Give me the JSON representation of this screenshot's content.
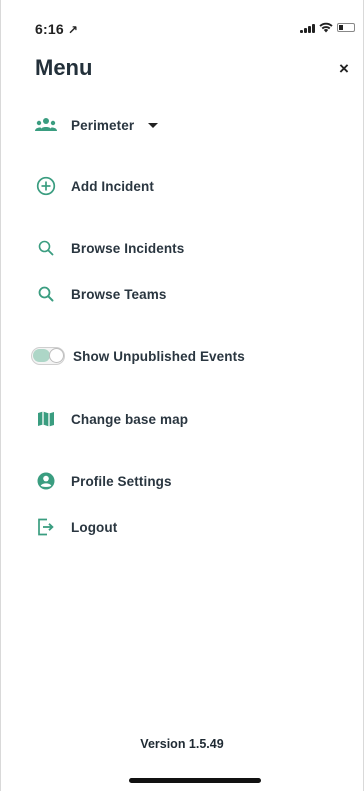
{
  "status_bar": {
    "time": "6:16",
    "location_glyph": "↗"
  },
  "header": {
    "title": "Menu",
    "close_glyph": "×"
  },
  "menu": {
    "team_selector": {
      "label": "Perimeter",
      "icon": "team-icon"
    },
    "items": [
      {
        "label": "Add Incident",
        "icon": "add-circle-icon"
      },
      {
        "label": "Browse Incidents",
        "icon": "search-icon"
      },
      {
        "label": "Browse Teams",
        "icon": "search-icon"
      },
      {
        "label": "Show Unpublished Events",
        "icon": "toggle"
      },
      {
        "label": "Change base map",
        "icon": "map-icon"
      },
      {
        "label": "Profile Settings",
        "icon": "account-icon"
      },
      {
        "label": "Logout",
        "icon": "logout-icon"
      }
    ]
  },
  "footer": {
    "version": "Version 1.5.49"
  },
  "colors": {
    "accent": "#3a9d80",
    "text": "#2a3640"
  }
}
